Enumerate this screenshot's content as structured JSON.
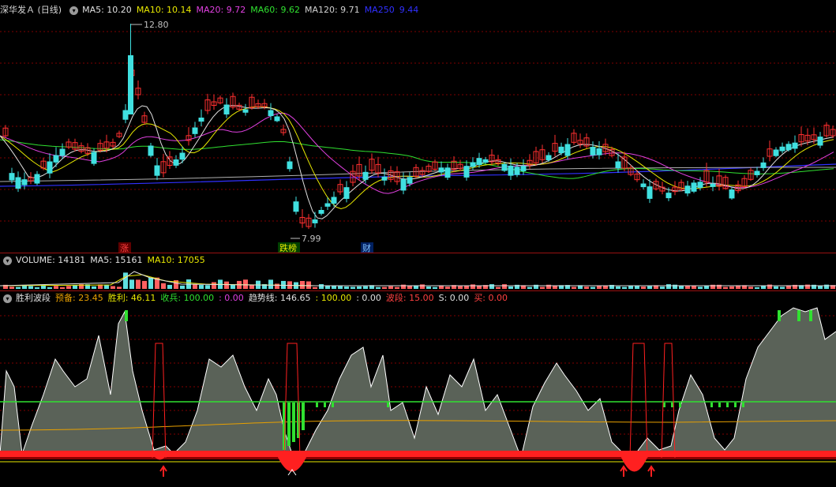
{
  "main": {
    "title": "深华发Ａ (日线)",
    "ma": [
      {
        "label": "MA5: 10.20",
        "color": "#e0e0e0"
      },
      {
        "label": "MA10: 10.14",
        "color": "#e8e800"
      },
      {
        "label": "MA20: 9.72",
        "color": "#e040e0"
      },
      {
        "label": "MA60: 9.62",
        "color": "#30e030"
      },
      {
        "label": "MA120: 9.71",
        "color": "#d0d0d0"
      },
      {
        "label": "MA250",
        "color": "#3030ff"
      },
      {
        "label": "9.44",
        "color": "#3030ff"
      }
    ],
    "high_label": "12.80",
    "low_label": "7.99",
    "marks": [
      {
        "text": "涨",
        "color": "#ff4040",
        "bg": "#600000"
      },
      {
        "text": "跌榜",
        "color": "#e8e800",
        "bg": "#004000"
      },
      {
        "text": "财",
        "color": "#80c0ff",
        "bg": "#002060"
      }
    ]
  },
  "volume": {
    "items": [
      {
        "label": "VOLUME: 14181",
        "color": "#e0e0e0"
      },
      {
        "label": "MA5: 15161",
        "color": "#e0e0e0"
      },
      {
        "label": "MA10: 17055",
        "color": "#e8e800"
      }
    ]
  },
  "indicator": {
    "items": [
      {
        "label": "胜利波段",
        "color": "#e0e0e0"
      },
      {
        "label": "预备: 23.45",
        "color": "#e8a000"
      },
      {
        "label": "胜利: 46.11",
        "color": "#e8e800"
      },
      {
        "label": "收兵: 100.00",
        "color": "#30e030"
      },
      {
        "label": ": 0.00",
        "color": "#e040e0"
      },
      {
        "label": "趋势线: 146.65",
        "color": "#e0e0e0"
      },
      {
        "label": ": 100.00",
        "color": "#e8e800"
      },
      {
        "label": ": 0.00",
        "color": "#e0e0e0"
      },
      {
        "label": "波段: 15.00",
        "color": "#ff4040"
      },
      {
        "label": "S: 0.00",
        "color": "#e0e0e0"
      },
      {
        "label": "买: 0.00",
        "color": "#ff4040"
      }
    ]
  },
  "colors": {
    "up": "#ff3030",
    "down": "#40e0e0",
    "grid": "#800000",
    "bg": "#000000"
  }
}
